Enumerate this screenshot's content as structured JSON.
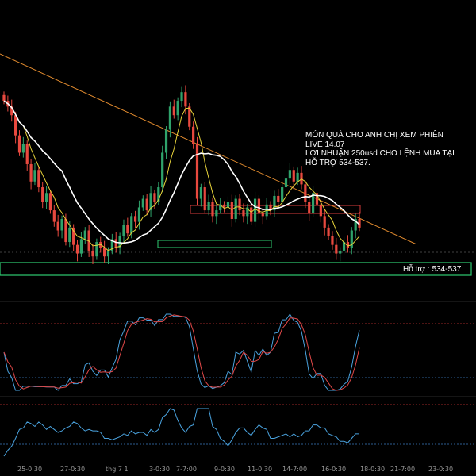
{
  "chart_data": {
    "type": "candlestick",
    "title": "",
    "annotation": [
      "MÓN QUÀ CHO ANH CHỊ XEM PHIÊN",
      "LIVE 14.07",
      "LỢI NHUẬN 250usd CHO LỆNH MUA TẠI",
      "HỖ TRỢ 534-537."
    ],
    "support_label": "Hỗ trợ : 534-537",
    "x_tick_labels": [
      "25-0:30",
      "27-0:30",
      "thg 7 1",
      "3-0:30",
      "7-7:00",
      "9-0:30",
      "11-0:30",
      "14-7:00",
      "16-0:30",
      "18-0:30",
      "21-7:00",
      "23-0:30"
    ],
    "series": [
      {
        "name": "",
        "kind": "price",
        "closes": [
          590,
          588,
          585,
          578,
          572,
          575,
          568,
          562,
          566,
          560,
          555,
          558,
          552,
          548,
          545,
          549,
          541,
          546,
          540,
          537,
          542,
          545,
          538,
          536,
          541,
          539,
          536,
          538,
          542,
          539,
          543,
          547,
          544,
          550,
          548,
          553,
          556,
          552,
          558,
          555,
          560,
          572,
          580,
          588,
          585,
          590,
          593,
          588,
          581,
          575,
          556,
          560,
          552,
          555,
          550,
          552,
          554,
          553,
          555,
          549,
          556,
          552,
          550,
          553,
          548,
          556,
          551,
          550,
          554,
          552,
          557,
          555,
          560,
          563,
          566,
          562,
          565,
          561,
          555,
          551,
          558,
          554,
          550,
          546,
          543,
          540,
          537,
          538,
          541,
          539,
          545,
          549,
          546
        ]
      },
      {
        "name": "",
        "kind": "fast-moving-average"
      },
      {
        "name": "",
        "kind": "slow-moving-average"
      },
      {
        "name": "",
        "kind": "oscillator-1"
      },
      {
        "name": "",
        "kind": "oscillator-2"
      }
    ],
    "grid": false,
    "legend": "none",
    "colors": {
      "up": "#2fa36b",
      "down": "#e8493f",
      "fast_ma": "#e6d23a",
      "slow_ma": "#ffffff",
      "trendline": "#e08a2e",
      "support_box": "#2ecc71",
      "resistance_box": "#d63b3b",
      "oscillator_main": "#4aa3df",
      "oscillator_signal": "#e04848"
    }
  }
}
